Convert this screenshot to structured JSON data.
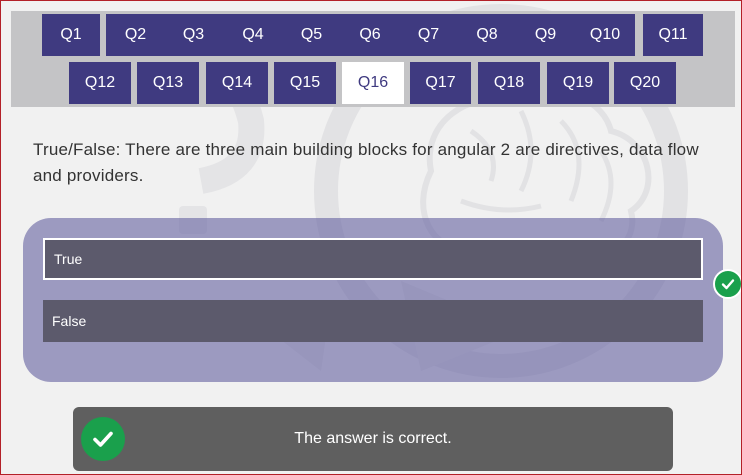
{
  "nav": {
    "row1": [
      "Q1",
      "Q2",
      "Q3",
      "Q4",
      "Q5",
      "Q6",
      "Q7",
      "Q8",
      "Q9",
      "Q10",
      "Q11"
    ],
    "row2": [
      "Q12",
      "Q13",
      "Q14",
      "Q15",
      "Q16",
      "Q17",
      "Q18",
      "Q19",
      "Q20"
    ],
    "active": "Q16"
  },
  "question": {
    "text": "True/False: There are three main building blocks for angular 2 are directives, data flow and providers."
  },
  "options": [
    {
      "label": "True",
      "selected": true
    },
    {
      "label": "False",
      "selected": false
    }
  ],
  "feedback": {
    "text": "The answer is correct.",
    "icon": "check-icon"
  },
  "colors": {
    "nav_button": "#3f3a80",
    "nav_active": "#ffffff",
    "correct": "#1aa04c",
    "option_bg": "#5c5a6c",
    "feedback_bg": "#5f5f5f"
  }
}
